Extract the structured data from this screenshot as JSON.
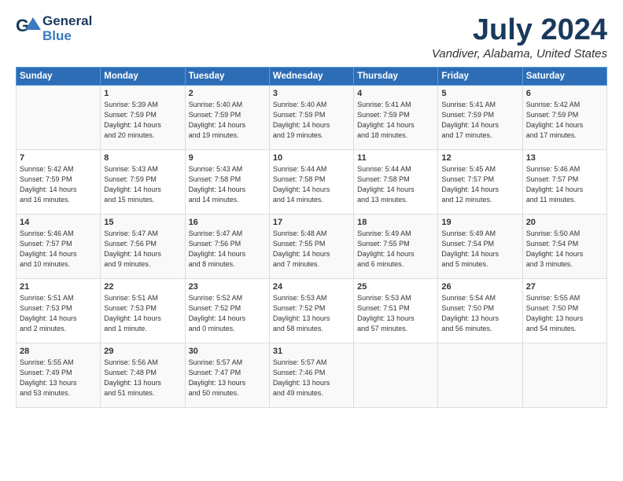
{
  "header": {
    "logo_general": "General",
    "logo_blue": "Blue",
    "month_title": "July 2024",
    "location": "Vandiver, Alabama, United States"
  },
  "weekdays": [
    "Sunday",
    "Monday",
    "Tuesday",
    "Wednesday",
    "Thursday",
    "Friday",
    "Saturday"
  ],
  "weeks": [
    [
      {
        "num": "",
        "lines": []
      },
      {
        "num": "1",
        "lines": [
          "Sunrise: 5:39 AM",
          "Sunset: 7:59 PM",
          "Daylight: 14 hours",
          "and 20 minutes."
        ]
      },
      {
        "num": "2",
        "lines": [
          "Sunrise: 5:40 AM",
          "Sunset: 7:59 PM",
          "Daylight: 14 hours",
          "and 19 minutes."
        ]
      },
      {
        "num": "3",
        "lines": [
          "Sunrise: 5:40 AM",
          "Sunset: 7:59 PM",
          "Daylight: 14 hours",
          "and 19 minutes."
        ]
      },
      {
        "num": "4",
        "lines": [
          "Sunrise: 5:41 AM",
          "Sunset: 7:59 PM",
          "Daylight: 14 hours",
          "and 18 minutes."
        ]
      },
      {
        "num": "5",
        "lines": [
          "Sunrise: 5:41 AM",
          "Sunset: 7:59 PM",
          "Daylight: 14 hours",
          "and 17 minutes."
        ]
      },
      {
        "num": "6",
        "lines": [
          "Sunrise: 5:42 AM",
          "Sunset: 7:59 PM",
          "Daylight: 14 hours",
          "and 17 minutes."
        ]
      }
    ],
    [
      {
        "num": "7",
        "lines": [
          "Sunrise: 5:42 AM",
          "Sunset: 7:59 PM",
          "Daylight: 14 hours",
          "and 16 minutes."
        ]
      },
      {
        "num": "8",
        "lines": [
          "Sunrise: 5:43 AM",
          "Sunset: 7:59 PM",
          "Daylight: 14 hours",
          "and 15 minutes."
        ]
      },
      {
        "num": "9",
        "lines": [
          "Sunrise: 5:43 AM",
          "Sunset: 7:58 PM",
          "Daylight: 14 hours",
          "and 14 minutes."
        ]
      },
      {
        "num": "10",
        "lines": [
          "Sunrise: 5:44 AM",
          "Sunset: 7:58 PM",
          "Daylight: 14 hours",
          "and 14 minutes."
        ]
      },
      {
        "num": "11",
        "lines": [
          "Sunrise: 5:44 AM",
          "Sunset: 7:58 PM",
          "Daylight: 14 hours",
          "and 13 minutes."
        ]
      },
      {
        "num": "12",
        "lines": [
          "Sunrise: 5:45 AM",
          "Sunset: 7:57 PM",
          "Daylight: 14 hours",
          "and 12 minutes."
        ]
      },
      {
        "num": "13",
        "lines": [
          "Sunrise: 5:46 AM",
          "Sunset: 7:57 PM",
          "Daylight: 14 hours",
          "and 11 minutes."
        ]
      }
    ],
    [
      {
        "num": "14",
        "lines": [
          "Sunrise: 5:46 AM",
          "Sunset: 7:57 PM",
          "Daylight: 14 hours",
          "and 10 minutes."
        ]
      },
      {
        "num": "15",
        "lines": [
          "Sunrise: 5:47 AM",
          "Sunset: 7:56 PM",
          "Daylight: 14 hours",
          "and 9 minutes."
        ]
      },
      {
        "num": "16",
        "lines": [
          "Sunrise: 5:47 AM",
          "Sunset: 7:56 PM",
          "Daylight: 14 hours",
          "and 8 minutes."
        ]
      },
      {
        "num": "17",
        "lines": [
          "Sunrise: 5:48 AM",
          "Sunset: 7:55 PM",
          "Daylight: 14 hours",
          "and 7 minutes."
        ]
      },
      {
        "num": "18",
        "lines": [
          "Sunrise: 5:49 AM",
          "Sunset: 7:55 PM",
          "Daylight: 14 hours",
          "and 6 minutes."
        ]
      },
      {
        "num": "19",
        "lines": [
          "Sunrise: 5:49 AM",
          "Sunset: 7:54 PM",
          "Daylight: 14 hours",
          "and 5 minutes."
        ]
      },
      {
        "num": "20",
        "lines": [
          "Sunrise: 5:50 AM",
          "Sunset: 7:54 PM",
          "Daylight: 14 hours",
          "and 3 minutes."
        ]
      }
    ],
    [
      {
        "num": "21",
        "lines": [
          "Sunrise: 5:51 AM",
          "Sunset: 7:53 PM",
          "Daylight: 14 hours",
          "and 2 minutes."
        ]
      },
      {
        "num": "22",
        "lines": [
          "Sunrise: 5:51 AM",
          "Sunset: 7:53 PM",
          "Daylight: 14 hours",
          "and 1 minute."
        ]
      },
      {
        "num": "23",
        "lines": [
          "Sunrise: 5:52 AM",
          "Sunset: 7:52 PM",
          "Daylight: 14 hours",
          "and 0 minutes."
        ]
      },
      {
        "num": "24",
        "lines": [
          "Sunrise: 5:53 AM",
          "Sunset: 7:52 PM",
          "Daylight: 13 hours",
          "and 58 minutes."
        ]
      },
      {
        "num": "25",
        "lines": [
          "Sunrise: 5:53 AM",
          "Sunset: 7:51 PM",
          "Daylight: 13 hours",
          "and 57 minutes."
        ]
      },
      {
        "num": "26",
        "lines": [
          "Sunrise: 5:54 AM",
          "Sunset: 7:50 PM",
          "Daylight: 13 hours",
          "and 56 minutes."
        ]
      },
      {
        "num": "27",
        "lines": [
          "Sunrise: 5:55 AM",
          "Sunset: 7:50 PM",
          "Daylight: 13 hours",
          "and 54 minutes."
        ]
      }
    ],
    [
      {
        "num": "28",
        "lines": [
          "Sunrise: 5:55 AM",
          "Sunset: 7:49 PM",
          "Daylight: 13 hours",
          "and 53 minutes."
        ]
      },
      {
        "num": "29",
        "lines": [
          "Sunrise: 5:56 AM",
          "Sunset: 7:48 PM",
          "Daylight: 13 hours",
          "and 51 minutes."
        ]
      },
      {
        "num": "30",
        "lines": [
          "Sunrise: 5:57 AM",
          "Sunset: 7:47 PM",
          "Daylight: 13 hours",
          "and 50 minutes."
        ]
      },
      {
        "num": "31",
        "lines": [
          "Sunrise: 5:57 AM",
          "Sunset: 7:46 PM",
          "Daylight: 13 hours",
          "and 49 minutes."
        ]
      },
      {
        "num": "",
        "lines": []
      },
      {
        "num": "",
        "lines": []
      },
      {
        "num": "",
        "lines": []
      }
    ]
  ]
}
